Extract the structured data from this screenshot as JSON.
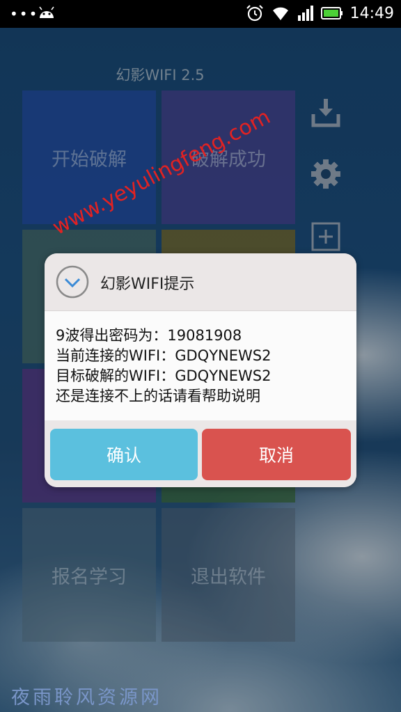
{
  "status_bar": {
    "time": "14:49",
    "notification_dots": "•••",
    "icons": [
      "android-icon",
      "alarm-icon",
      "wifi-icon",
      "signal-icon",
      "battery-icon"
    ]
  },
  "app": {
    "title": "幻影WIFI 2.5",
    "tiles": {
      "start_crack": "开始破解",
      "crack_success": "破解成功",
      "signup_learn": "报名学习",
      "exit_software": "退出软件"
    },
    "side_icons": [
      "download-icon",
      "gear-icon",
      "add-icon"
    ]
  },
  "dialog": {
    "title": "幻影WIFI提示",
    "lines": [
      "9波得出密码为：19081908",
      "当前连接的WIFI：GDQYNEWS2",
      "目标破解的WIFI：GDQYNEWS2",
      "还是连接不上的话请看帮助说明"
    ],
    "confirm_label": "确认",
    "cancel_label": "取消"
  },
  "watermarks": {
    "url": "www.yeyulingfeng.com",
    "site_name": "夜雨聆风资源网"
  },
  "colors": {
    "confirm_button": "#5bc0de",
    "cancel_button": "#d9534f",
    "watermark_url": "#e22222"
  }
}
